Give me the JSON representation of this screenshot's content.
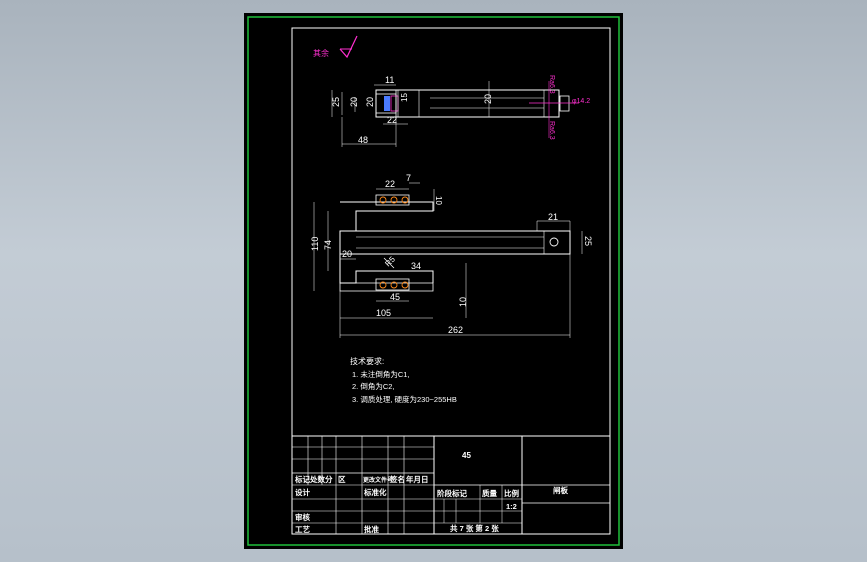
{
  "drawing": {
    "surface_symbol": "其余",
    "top_view": {
      "dims": [
        "11",
        "20",
        "25",
        "20",
        "15",
        "22",
        "48",
        "20"
      ],
      "callouts": [
        "φ14.2",
        "Ra6.3",
        "Ra6.3"
      ]
    },
    "front_view": {
      "dims": [
        "22",
        "7",
        "10",
        "21",
        "110",
        "74",
        "25",
        "20",
        "34",
        "45",
        "10",
        "105",
        "262"
      ],
      "callout": "R5"
    },
    "notes": {
      "title": "技术要求:",
      "items": [
        "1. 未注倒角为C1,",
        "2. 倒角为C2,",
        "3. 调质处理, 硬度为230~255HB"
      ]
    },
    "title_block": {
      "material": "45",
      "part_name": "闸板",
      "row_labels": [
        "标记",
        "处数",
        "分",
        "区",
        "更改文件号",
        "签名",
        "年月日"
      ],
      "designer_label": "设计",
      "standardize_label": "标准化",
      "review_label": "审核",
      "process_label": "工艺",
      "approve_label": "批准",
      "stage_header": [
        "阶段标记",
        "质量",
        "比例"
      ],
      "scale": "1:2",
      "sheet_text": "共 7 张  第 2 张"
    }
  },
  "colors": {
    "background_black": "#000000",
    "frame_white": "#ffffff",
    "outer_frame_green": "#1fbf3a",
    "annotation_magenta": "#ff2fd0",
    "hidden_line_blue": "#4a7bff",
    "screen_gray": "#b8c1ca"
  }
}
